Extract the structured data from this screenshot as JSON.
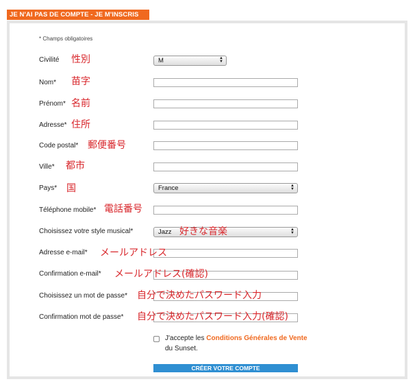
{
  "header": {
    "title": "JE N'AI PAS DE COMPTE - JE M'INSCRIS"
  },
  "form": {
    "required_note": "* Champs obligatoires",
    "civilite": {
      "label": "Civilité",
      "value": "M",
      "annotation": "性別"
    },
    "nom": {
      "label": "Nom*",
      "value": "",
      "annotation": "苗字"
    },
    "prenom": {
      "label": "Prénom*",
      "value": "",
      "annotation": "名前"
    },
    "adresse": {
      "label": "Adresse*",
      "value": "",
      "annotation": "住所"
    },
    "code_postal": {
      "label": "Code postal*",
      "value": "",
      "annotation": "郵便番号"
    },
    "ville": {
      "label": "Ville*",
      "value": "",
      "annotation": "都市"
    },
    "pays": {
      "label": "Pays*",
      "value": "France",
      "annotation": "国"
    },
    "telephone": {
      "label": "Téléphone mobile*",
      "value": "",
      "annotation": "電話番号"
    },
    "style": {
      "label": "Choisissez votre style musical*",
      "value": "Jazz",
      "annotation": "好きな音楽"
    },
    "email": {
      "label": "Adresse e-mail*",
      "value": "",
      "annotation": "メールアドレス"
    },
    "email_confirm": {
      "label": "Confirmation e-mail*",
      "value": "",
      "annotation": "メールアドレス(確認)"
    },
    "password": {
      "label": "Choisissez un mot de passe*",
      "value": "",
      "annotation": "自分で決めたパスワード入力"
    },
    "password_confirm": {
      "label": "Confirmation mot de passe*",
      "value": "",
      "annotation": "自分で決めたパスワード入力(確認)"
    },
    "terms": {
      "prefix": "J'accepte les ",
      "link": "Conditions Générales de Vente",
      "suffix": " du Sunset.",
      "checked": false
    },
    "submit_label": "CRÉER VOTRE COMPTE"
  },
  "colors": {
    "accent": "#f0691f",
    "button": "#2f8fd2",
    "annotation": "#d8262b",
    "panel_border": "#e5e5e5"
  },
  "icons": {
    "select_arrows": "up-down-arrows-icon"
  }
}
